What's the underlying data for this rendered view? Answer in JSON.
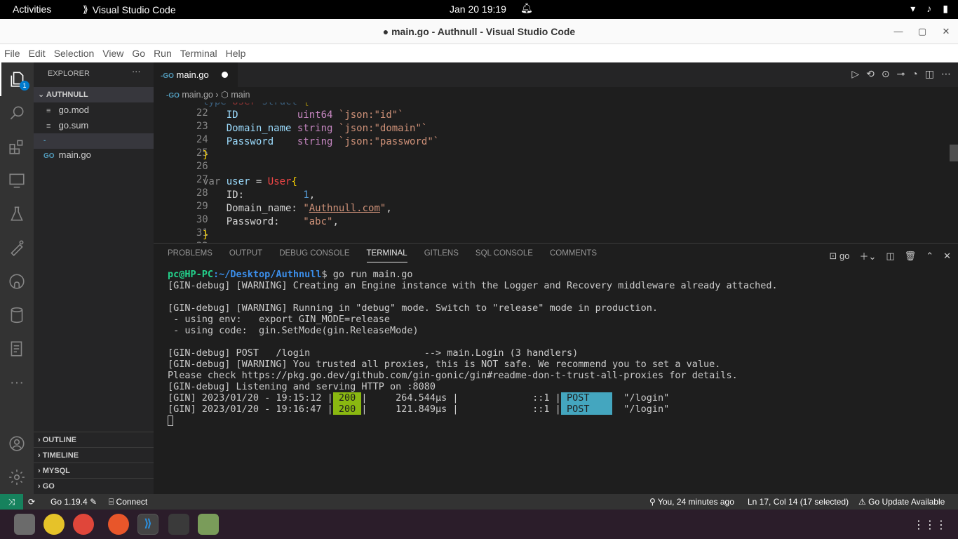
{
  "gnome": {
    "activities": "Activities",
    "app_name": "Visual Studio Code",
    "clock": "Jan 20  19:19"
  },
  "window": {
    "title": "● main.go - Authnull - Visual Studio Code"
  },
  "menu": [
    "File",
    "Edit",
    "Selection",
    "View",
    "Go",
    "Run",
    "Terminal",
    "Help"
  ],
  "activity_badge": "1",
  "sidebar": {
    "title": "EXPLORER",
    "more": "···",
    "folder": "AUTHNULL",
    "files": [
      {
        "name": "go.mod",
        "icon": "≡"
      },
      {
        "name": "go.sum",
        "icon": "≡"
      },
      {
        "name": "main.go",
        "icon": "-GO"
      }
    ],
    "bottom_sections": [
      "OUTLINE",
      "TIMELINE",
      "MYSQL",
      "GO"
    ]
  },
  "tab": {
    "name": "main.go",
    "icon": "-GO"
  },
  "breadcrumb": {
    "file": "main.go",
    "symbol": "main"
  },
  "code": {
    "lines": [
      {
        "n": "22",
        "tokens": []
      },
      {
        "n": "23",
        "text": "    ID          uint64 `json:\"id\"`"
      },
      {
        "n": "24",
        "text": "    Domain_name string `json:\"domain\"`"
      },
      {
        "n": "25",
        "text": "    Password    string `json:\"password\"`"
      },
      {
        "n": "26",
        "text": "}"
      },
      {
        "n": "27",
        "text": ""
      },
      {
        "n": "28",
        "text": "var user = User{"
      },
      {
        "n": "29",
        "text": "    ID:          1,"
      },
      {
        "n": "30",
        "text": "    Domain_name: \"Authnull.com\","
      },
      {
        "n": "31",
        "text": "    Password:    \"abc\","
      },
      {
        "n": "32",
        "text": "}"
      }
    ],
    "line22_text": "type User struct {"
  },
  "panel": {
    "tabs": [
      "PROBLEMS",
      "OUTPUT",
      "DEBUG CONSOLE",
      "TERMINAL",
      "GITLENS",
      "SQL CONSOLE",
      "COMMENTS"
    ],
    "active_tab": "TERMINAL",
    "terminal_name": "go"
  },
  "terminal": {
    "prompt_user": "pc@HP-PC",
    "prompt_path": ":~/Desktop/Authnull",
    "command": "$ go run main.go",
    "lines": [
      "[GIN-debug] [WARNING] Creating an Engine instance with the Logger and Recovery middleware already attached.",
      "",
      "[GIN-debug] [WARNING] Running in \"debug\" mode. Switch to \"release\" mode in production.",
      " - using env:   export GIN_MODE=release",
      " - using code:  gin.SetMode(gin.ReleaseMode)",
      "",
      "[GIN-debug] POST   /login                    --> main.Login (3 handlers)",
      "[GIN-debug] [WARNING] You trusted all proxies, this is NOT safe. We recommend you to set a value.",
      "Please check https://pkg.go.dev/github.com/gin-gonic/gin#readme-don-t-trust-all-proxies for details.",
      "[GIN-debug] Listening and serving HTTP on :8080"
    ],
    "requests": [
      {
        "prefix": "[GIN] 2023/01/20 - 19:15:12 |",
        "status": " 200 ",
        "mid": "|     264.544µs |             ::1 |",
        "method": " POST    ",
        "path": "  \"/login\""
      },
      {
        "prefix": "[GIN] 2023/01/20 - 19:16:47 |",
        "status": " 200 ",
        "mid": "|     121.849µs |             ::1 |",
        "method": " POST    ",
        "path": "  \"/login\""
      }
    ]
  },
  "status": {
    "go_version": "Go 1.19.4",
    "connect": "Connect",
    "blame": "You, 24 minutes ago",
    "position": "Ln 17, Col 14 (17 selected)",
    "update": "Go Update Available"
  }
}
